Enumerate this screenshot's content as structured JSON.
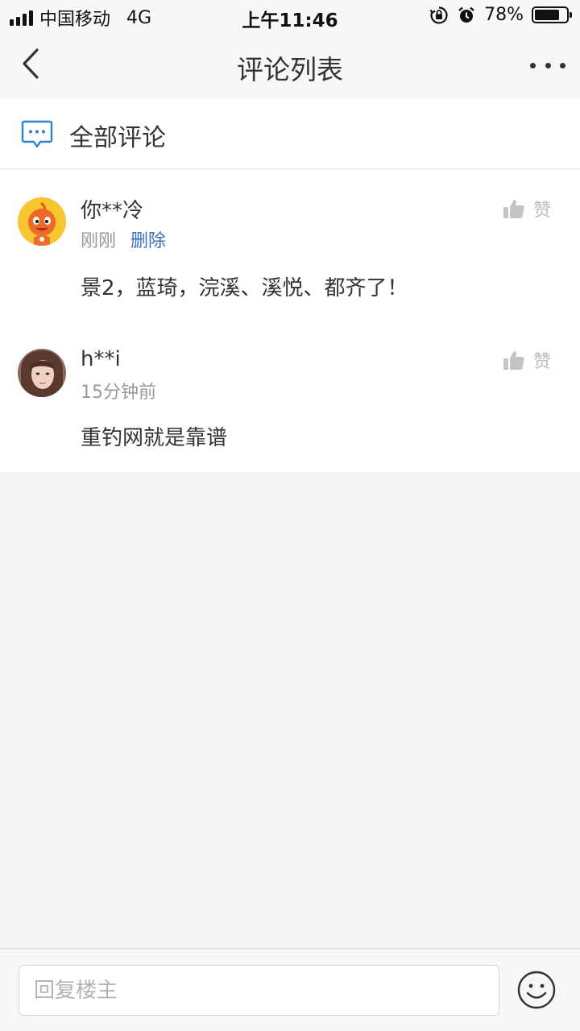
{
  "status_bar": {
    "carrier": "中国移动",
    "network": "4G",
    "time": "上午11:46",
    "battery": "78%",
    "battery_level": 0.78
  },
  "nav": {
    "title": "评论列表"
  },
  "section": {
    "title": "全部评论"
  },
  "comments": [
    {
      "username": "你**冷",
      "time": "刚刚",
      "delete_label": "删除",
      "content": "景2，蓝琦，浣溪、溪悦、都齐了！",
      "like_label": "赞"
    },
    {
      "username": "h**i",
      "time": "15分钟前",
      "content": "重钓网就是靠谱",
      "like_label": "赞"
    }
  ],
  "reply": {
    "placeholder": "回复楼主"
  },
  "colors": {
    "accent_blue": "#3a6fb4",
    "icon_blue": "#2f7fd6",
    "like_gray": "#c4c4c4"
  }
}
